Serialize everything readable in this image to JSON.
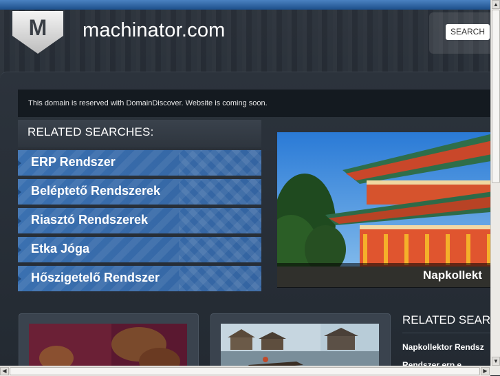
{
  "header": {
    "logo_letter": "M",
    "site_title": "machinator.com",
    "search_label": "SEARCH"
  },
  "notice": {
    "text": "This domain is reserved with DomainDiscover. Website is coming soon."
  },
  "related_searches": {
    "heading": "RELATED SEARCHES:",
    "items": [
      {
        "label": "ERP Rendszer"
      },
      {
        "label": "Beléptető Rendszerek"
      },
      {
        "label": "Riasztó Rendszerek"
      },
      {
        "label": "Etka Jóga"
      },
      {
        "label": "Hőszigetelő Rendszer"
      }
    ]
  },
  "featured": {
    "caption": "Napkollekt"
  },
  "sidebar": {
    "heading": "RELATED SEAR",
    "links": [
      {
        "label": "Napkollektor Rendsz"
      },
      {
        "label": "Rendszer  erp e"
      }
    ]
  },
  "colors": {
    "accent_blue": "#3a70b0",
    "background": "#1f252d"
  }
}
